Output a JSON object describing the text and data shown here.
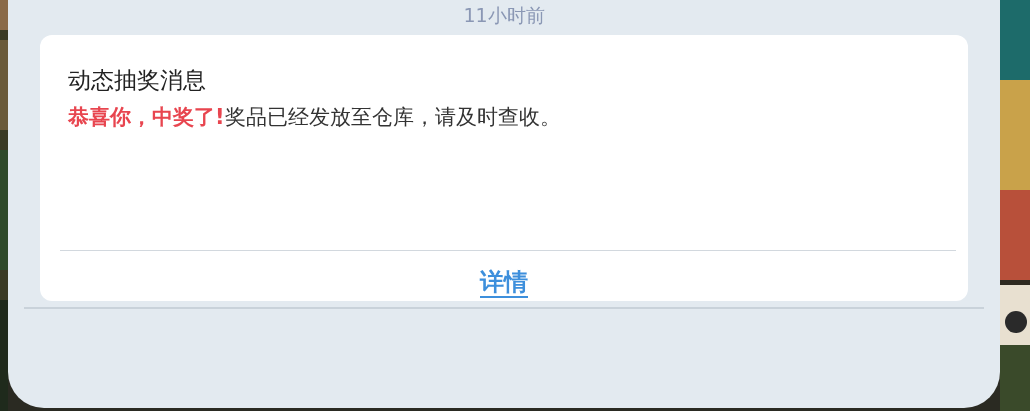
{
  "time_label": "11小时前",
  "card": {
    "title": "动态抽奖消息",
    "message": {
      "highlight": "恭喜你，中奖了!",
      "text": "奖品已经发放至仓库，请及时查收。"
    },
    "link": "详情"
  }
}
